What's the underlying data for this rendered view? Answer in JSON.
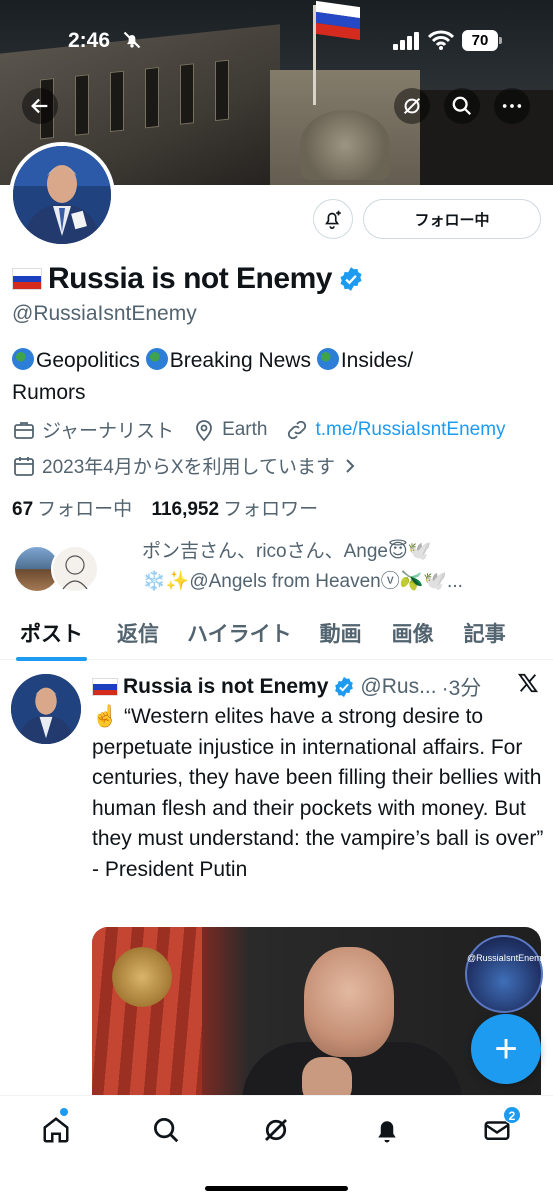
{
  "status_bar": {
    "time": "2:46",
    "battery": "70"
  },
  "profile": {
    "flag": "🇷🇺",
    "display_name": "Russia is not Enemy",
    "handle": "@RussiaIsntEnemy",
    "follow_button": "フォロー中",
    "bio_line1_parts": [
      "Geopolitics",
      "Breaking News",
      "Insides/"
    ],
    "bio_line2": "Rumors",
    "category": "ジャーナリスト",
    "location": "Earth",
    "link": "t.me/RussiaIsntEnemy",
    "joined": "2023年4月からXを利用しています",
    "following_count": "67",
    "following_label": "フォロー中",
    "followers_count": "116,952",
    "followers_label": "フォロワー",
    "followed_by_line1": "ポン吉さん、ricoさん、Ange😇🕊️",
    "followed_by_line2": "❄️✨@Angels from Heavenⓥ🫒🕊️..."
  },
  "tabs": [
    "ポスト",
    "返信",
    "ハイライト",
    "動画",
    "画像",
    "記事"
  ],
  "tweet": {
    "name": "Russia is not Enemy",
    "handle": "@Rus...",
    "time": "·3分",
    "text": "☝️ “Western elites have a strong desire to perpetuate injustice in international affairs. For centuries, they have been filling their bellies with human flesh and their pockets with money. But they must understand: the vampire’s ball is over” - President Putin",
    "watermark": "@RussiaIsntEnemy"
  },
  "fab_label": "+",
  "messages_badge": "2",
  "colors": {
    "accent": "#1d9bf0",
    "secondary_text": "#536471",
    "verified": "#1d9bf0"
  },
  "icons": [
    "back-icon",
    "grok-icon",
    "search-icon",
    "more-icon",
    "bell-plus-icon",
    "briefcase-icon",
    "location-icon",
    "link-icon",
    "calendar-icon",
    "verified-icon",
    "x-logo-icon",
    "home-icon",
    "notifications-icon",
    "messages-icon"
  ]
}
